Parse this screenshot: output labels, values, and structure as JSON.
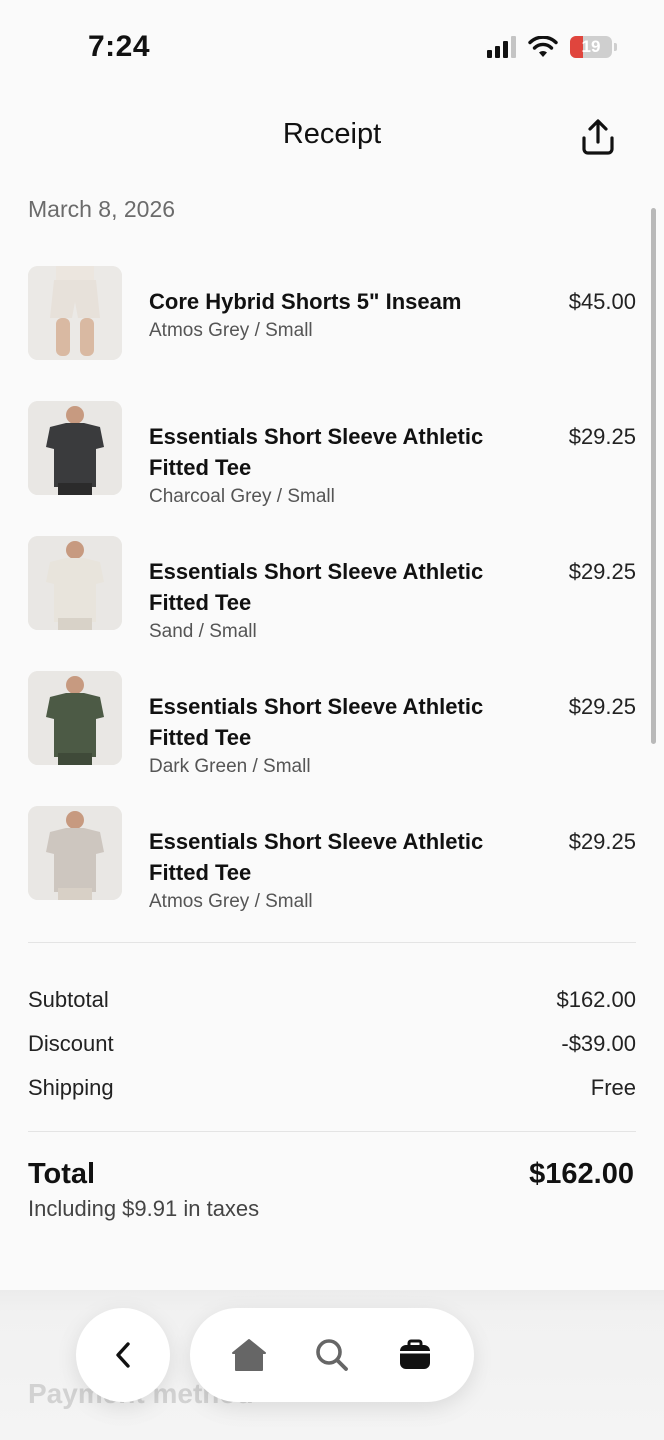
{
  "status_bar": {
    "time": "7:24",
    "battery": "19"
  },
  "header": {
    "title": "Receipt",
    "share_icon": "share-icon"
  },
  "date": "March 8, 2026",
  "items": [
    {
      "name": "Core Hybrid Shorts 5\" Inseam",
      "variant": "Atmos Grey / Small",
      "price": "$45.00",
      "color": "#e7e1da"
    },
    {
      "name": "Essentials Short Sleeve Athletic Fitted Tee",
      "variant": "Charcoal Grey / Small",
      "price": "$29.25",
      "color": "#3a3b3d"
    },
    {
      "name": "Essentials Short Sleeve Athletic Fitted Tee",
      "variant": "Sand / Small",
      "price": "$29.25",
      "color": "#e8e4dc"
    },
    {
      "name": "Essentials Short Sleeve Athletic Fitted Tee",
      "variant": "Dark Green / Small",
      "price": "$29.25",
      "color": "#4c5a45"
    },
    {
      "name": "Essentials Short Sleeve Athletic Fitted Tee",
      "variant": "Atmos Grey / Small",
      "price": "$29.25",
      "color": "#cdc6bf"
    }
  ],
  "summary": {
    "subtotal_label": "Subtotal",
    "subtotal_value": "$162.00",
    "discount_label": "Discount",
    "discount_value": "-$39.00",
    "shipping_label": "Shipping",
    "shipping_value": "Free"
  },
  "total": {
    "label": "Total",
    "value": "$162.00",
    "tax_note": "Including $9.91 in taxes"
  },
  "section_peek": "Payment method",
  "bottom_nav": {
    "back_icon": "chevron-left-icon",
    "items": [
      "home-icon",
      "search-icon",
      "bag-icon"
    ]
  }
}
